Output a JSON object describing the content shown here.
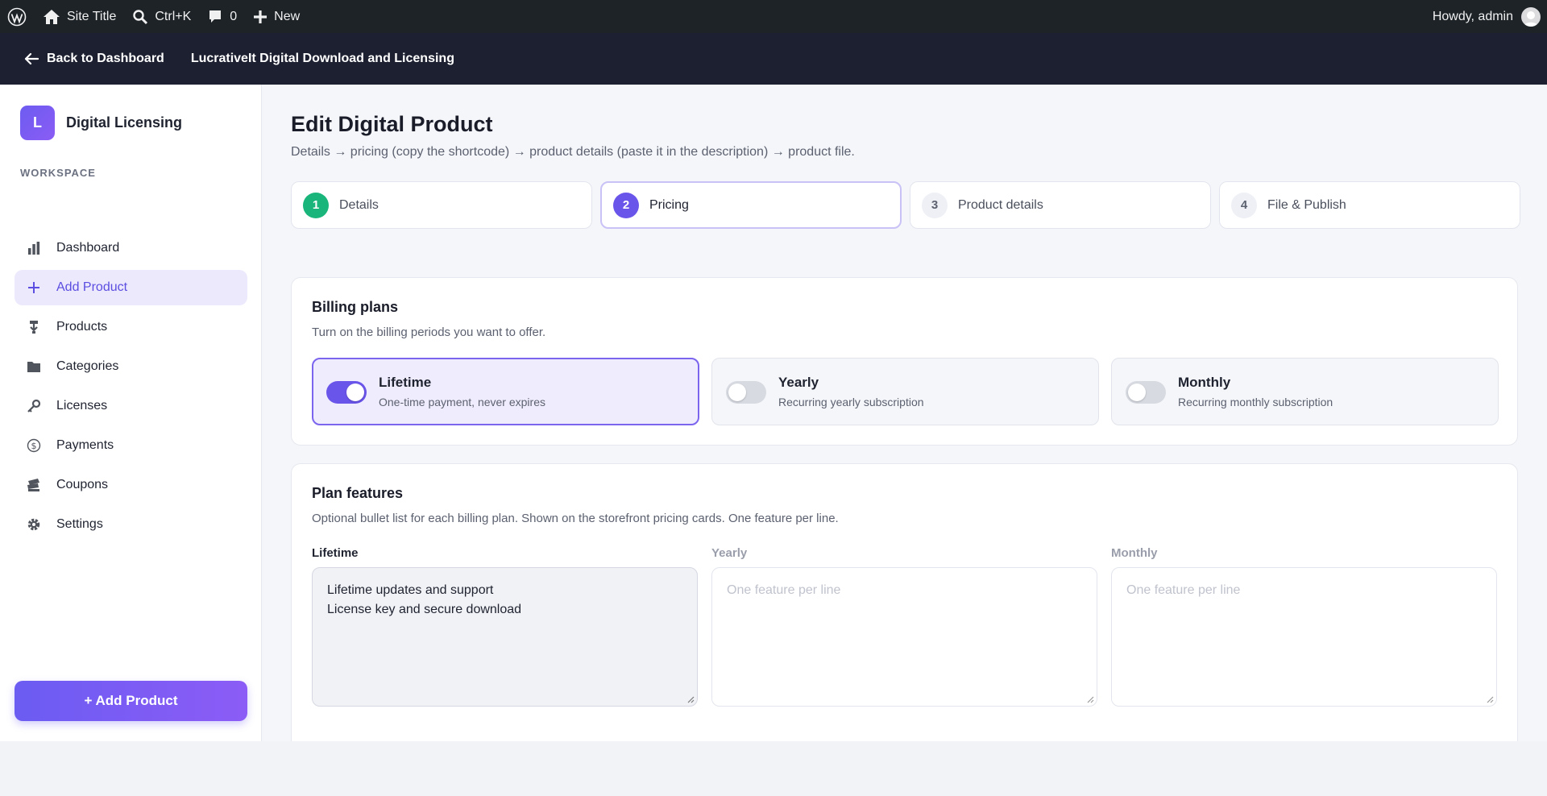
{
  "adminbar": {
    "site_title": "Site Title",
    "search_shortcut": "Ctrl+K",
    "comments_count": "0",
    "new_label": "New",
    "greeting": "Howdy, admin"
  },
  "topbar": {
    "back_label": "Back to Dashboard",
    "app_name": "LucrativeIt Digital Download and Licensing"
  },
  "sidebar": {
    "logo_letter": "L",
    "logo_text": "Digital Licensing",
    "section_label": "WORKSPACE",
    "items": [
      {
        "label": "Dashboard",
        "icon": "bar-chart-icon"
      },
      {
        "label": "Add Product",
        "icon": "plus-icon",
        "active": true
      },
      {
        "label": "Products",
        "icon": "download-icon"
      },
      {
        "label": "Categories",
        "icon": "folder-icon"
      },
      {
        "label": "Licenses",
        "icon": "key-icon"
      },
      {
        "label": "Payments",
        "icon": "dollar-icon"
      },
      {
        "label": "Coupons",
        "icon": "tickets-icon"
      },
      {
        "label": "Settings",
        "icon": "gear-icon"
      }
    ],
    "add_button": "+ Add Product"
  },
  "main": {
    "title": "Edit Digital Product",
    "subtitle": "Details → pricing (copy the shortcode) → product details (paste it in the description) → product file.",
    "steps": [
      {
        "num": "1",
        "label": "Details",
        "state": "done"
      },
      {
        "num": "2",
        "label": "Pricing",
        "state": "current"
      },
      {
        "num": "3",
        "label": "Product details",
        "state": "pending"
      },
      {
        "num": "4",
        "label": "File & Publish",
        "state": "pending"
      }
    ],
    "billing": {
      "title": "Billing plans",
      "description": "Turn on the billing periods you want to offer.",
      "plans": [
        {
          "name": "Lifetime",
          "sub": "One-time payment, never expires",
          "enabled": true
        },
        {
          "name": "Yearly",
          "sub": "Recurring yearly subscription",
          "enabled": false
        },
        {
          "name": "Monthly",
          "sub": "Recurring monthly subscription",
          "enabled": false
        }
      ]
    },
    "features": {
      "title": "Plan features",
      "description": "Optional bullet list for each billing plan. Shown on the storefront pricing cards. One feature per line.",
      "columns": [
        {
          "label": "Lifetime",
          "lines": [
            "Lifetime updates and support",
            "License key and secure download"
          ],
          "placeholder": ""
        },
        {
          "label": "Yearly",
          "lines": [],
          "placeholder": "One feature per line"
        },
        {
          "label": "Monthly",
          "lines": [],
          "placeholder": "One feature per line"
        }
      ]
    }
  },
  "colors": {
    "accent": "#6a55ea",
    "success": "#19b57a",
    "adminbar": "#1d2327",
    "topbar": "#1d2030"
  }
}
